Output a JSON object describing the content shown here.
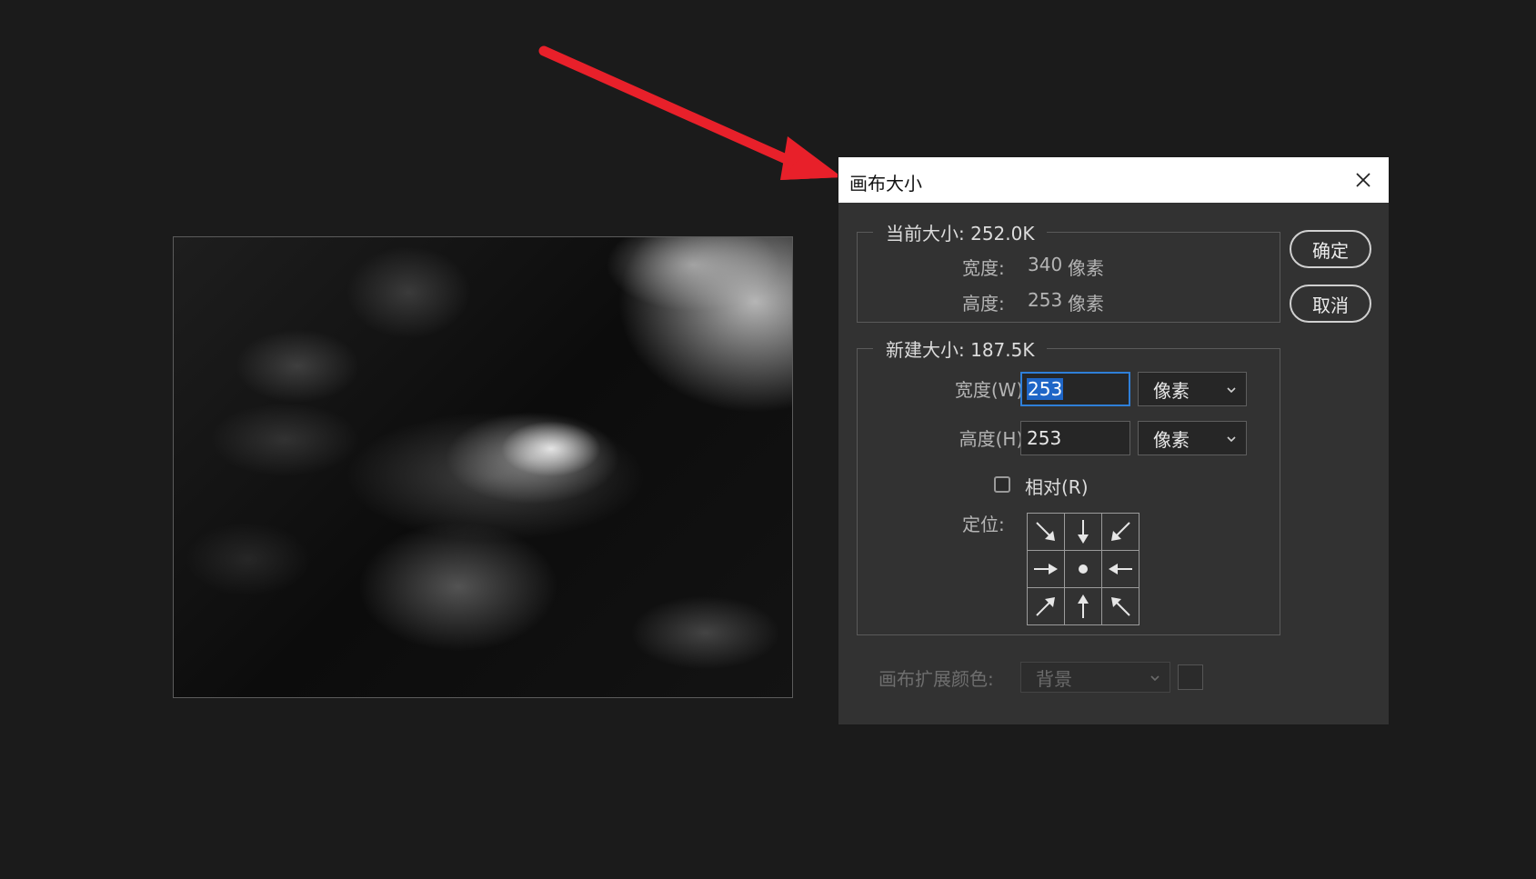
{
  "dialog": {
    "title": "画布大小",
    "close_icon": "close-icon",
    "current_size": {
      "legend": "当前大小: 252.0K",
      "width_label": "宽度:",
      "width_value": "340",
      "width_unit": "像素",
      "height_label": "高度:",
      "height_value": "253",
      "height_unit": "像素"
    },
    "new_size": {
      "legend": "新建大小: 187.5K",
      "width_label": "宽度(W):",
      "width_value": "253",
      "width_unit": "像素",
      "height_label": "高度(H):",
      "height_value": "253",
      "height_unit": "像素",
      "relative_label": "相对(R)",
      "relative_checked": false,
      "anchor_label": "定位:",
      "anchor_selected": "center"
    },
    "extension_color": {
      "label": "画布扩展颜色:",
      "value": "背景"
    },
    "ok_label": "确定",
    "cancel_label": "取消"
  },
  "colors": {
    "background": "#1b1b1b",
    "dialog_bg": "#323232",
    "accent": "#1f66c7",
    "annotation_arrow": "#e8202a"
  }
}
